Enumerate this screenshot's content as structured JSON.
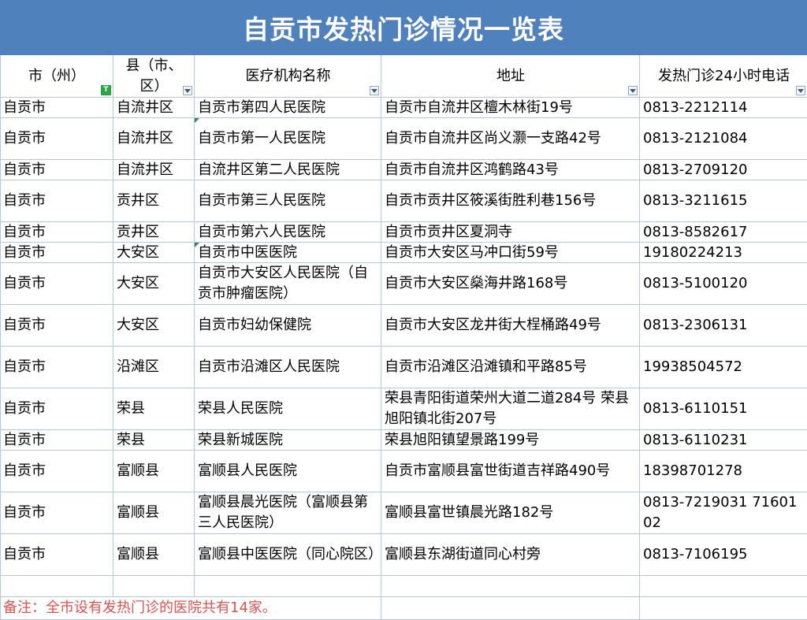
{
  "title": "自贡市发热门诊情况一览表",
  "headers": [
    "市（州）",
    "县（市、区）",
    "医疗机构名称",
    "地址",
    "发热门诊24小时电话"
  ],
  "rows": [
    [
      "自贡市",
      "自流井区",
      "自贡市第四人民医院",
      "自贡市自流井区檀木林街19号",
      "0813-2212114"
    ],
    [
      "自贡市",
      "自流井区",
      "自贡市第一人民医院",
      "自贡市自流井区尚义灏一支路42号",
      "0813-2121084"
    ],
    [
      "自贡市",
      "自流井区",
      "自流井区第二人民医院",
      "自贡市自流井区鸿鹤路43号",
      "0813-2709120"
    ],
    [
      "自贡市",
      "贡井区",
      "自贡市第三人民医院",
      "自贡市贡井区筱溪街胜利巷156号",
      "0813-3211615"
    ],
    [
      "自贡市",
      "贡井区",
      "自贡市第六人民医院",
      "自贡市贡井区夏洞寺",
      "0813-8582617"
    ],
    [
      "自贡市",
      "大安区",
      "自贡市中医医院",
      "自贡市大安区马冲口街59号",
      "19180224213"
    ],
    [
      "自贡市",
      "大安区",
      "自贡市大安区人民医院（自贡市肿瘤医院）",
      "自贡市大安区燊海井路168号",
      "0813-5100120"
    ],
    [
      "自贡市",
      "大安区",
      "自贡市妇幼保健院",
      "自贡市大安区龙井街大桯桶路49号",
      "0813-2306131"
    ],
    [
      "自贡市",
      "沿滩区",
      "自贡市沿滩区人民医院",
      "自贡市沿滩区沿滩镇和平路85号",
      "19938504572"
    ],
    [
      "自贡市",
      "荣县",
      "荣县人民医院",
      "荣县青阳街道荣州大道二道284号  荣县旭阳镇北街207号",
      "0813-6110151"
    ],
    [
      "自贡市",
      "荣县",
      "荣县新城医院",
      "荣县旭阳镇望景路199号",
      "0813-6110231"
    ],
    [
      "自贡市",
      "富顺县",
      "富顺县人民医院",
      "自贡市富顺县富世街道吉祥路490号",
      "18398701278"
    ],
    [
      "自贡市",
      "富顺县",
      "富顺县晨光医院（富顺县第三人民医院）",
      "富顺县富世镇晨光路182号",
      "0813-7219031 7160102"
    ],
    [
      "自贡市",
      "富顺县",
      "富顺县中医医院（同心院区）",
      "富顺县东湖街道同心村旁",
      "0813-7106195"
    ]
  ],
  "note": "备注：全市设有发热门诊的医院共有14家。",
  "colors": {
    "title_bg": "#4f81bd",
    "grid": "#b3c6e7",
    "note": "#e0504f"
  }
}
